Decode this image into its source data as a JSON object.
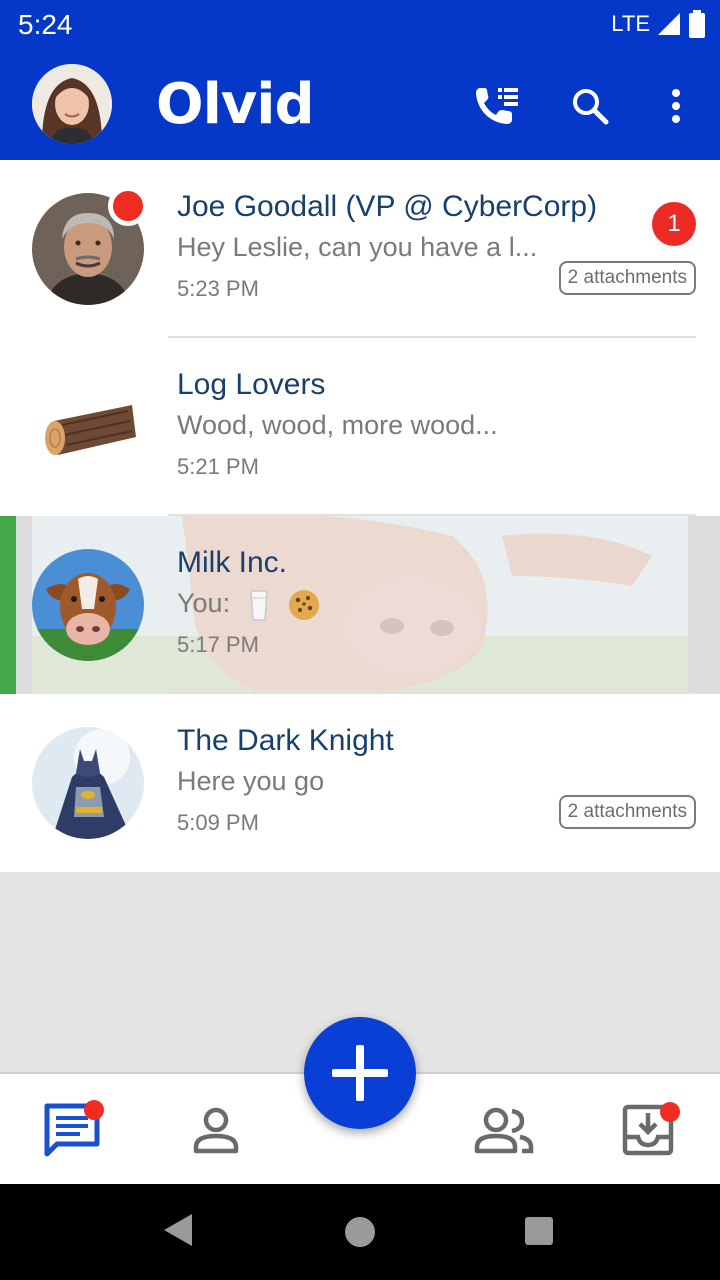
{
  "status_bar": {
    "time": "5:24",
    "network": "LTE"
  },
  "app_bar": {
    "title": "Olvid",
    "icons": [
      "profile-avatar",
      "call-log-icon",
      "search-icon",
      "more-vert-icon"
    ]
  },
  "discussions": [
    {
      "name": "Joe Goodall (VP @ CyberCorp)",
      "preview": "Hey Leslie, can you have a l...",
      "time": "5:23 PM",
      "attachments": "2 attachments",
      "unread": "1",
      "avatar": "man-avatar"
    },
    {
      "name": "Log Lovers",
      "preview": "Wood, wood, more wood...",
      "time": "5:21 PM",
      "avatar": "log-avatar"
    },
    {
      "name": "Milk Inc.",
      "preview": "You:",
      "time": "5:17 PM",
      "avatar": "cow-avatar",
      "emoji": [
        "milk-glass-icon",
        "cookie-icon"
      ]
    },
    {
      "name": "The Dark Knight",
      "preview": "Here you go",
      "time": "5:09 PM",
      "attachments": "2 attachments",
      "avatar": "batman-avatar"
    }
  ],
  "bottom_nav": [
    "discussions-icon",
    "contacts-icon",
    "groups-icon",
    "invitations-icon"
  ],
  "colors": {
    "primary": "#0537c8",
    "name_text": "#17406d",
    "badge": "#ee2c22",
    "swipe_green": "#43a948"
  }
}
